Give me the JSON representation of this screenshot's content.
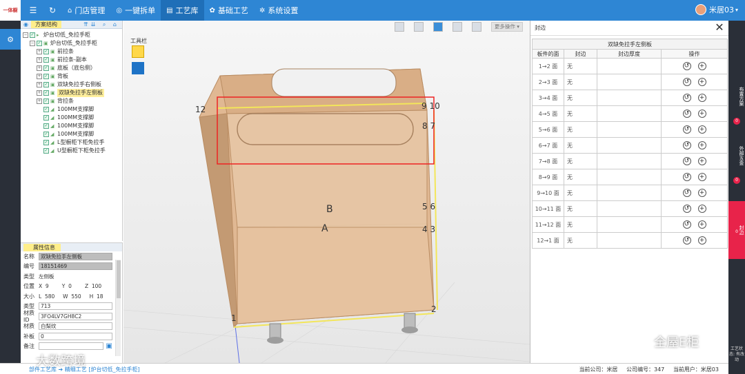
{
  "topbar": {
    "logo_text": "一体橱",
    "nav": [
      {
        "icon": "home-icon",
        "glyph": "⌂",
        "label": "门店管理"
      },
      {
        "icon": "shield-icon",
        "glyph": "◎",
        "label": "一键拆单"
      },
      {
        "icon": "book-icon",
        "glyph": "▤",
        "label": "工艺库"
      },
      {
        "icon": "palette-icon",
        "glyph": "✿",
        "label": "基础工艺"
      },
      {
        "icon": "gear-icon",
        "glyph": "✲",
        "label": "系统设置"
      }
    ],
    "username": "米居03"
  },
  "tree_panel": {
    "title": "方案结构",
    "items": [
      {
        "level": 0,
        "label": "炉台切低_免拉手柜"
      },
      {
        "level": 1,
        "label": "炉台切低_免拉手柜"
      },
      {
        "level": 2,
        "label": "前拉条"
      },
      {
        "level": 2,
        "label": "前拉条-副本"
      },
      {
        "level": 2,
        "label": "底板（底包侧）"
      },
      {
        "level": 2,
        "label": "背板"
      },
      {
        "level": 2,
        "label": "双缺免拉手右侧板"
      },
      {
        "level": 2,
        "label": "双缺免拉手左侧板",
        "selected": true
      },
      {
        "level": 2,
        "label": "背拉条"
      },
      {
        "level": 2,
        "label": "100MM支撑脚",
        "leaf": true
      },
      {
        "level": 2,
        "label": "100MM支撑脚",
        "leaf": true
      },
      {
        "level": 2,
        "label": "100MM支撑脚",
        "leaf": true
      },
      {
        "level": 2,
        "label": "100MM支撑脚",
        "leaf": true
      },
      {
        "level": 2,
        "label": "L型橱柜下柜免拉手",
        "leaf": true
      },
      {
        "level": 2,
        "label": "U型橱柜下柜免拉手",
        "leaf": true
      }
    ]
  },
  "prop_panel": {
    "title": "属性信息",
    "name_label": "名称",
    "name_value": "双缺免拉手左侧板",
    "code_label": "编号",
    "code_value": "18151469",
    "type_label": "类型",
    "type_value": "左侧板",
    "pos_label": "位置",
    "pos": "X  9        Y  0        Z  100",
    "size_label": "大小",
    "size": "L  580     W  550     H  18",
    "type2_label": "类型",
    "type2_value": "713",
    "matid_label": "材质ID",
    "matid_value": "3FO4LV7GH8C2",
    "mat_label": "材质",
    "mat_value": "白梨纹",
    "fill_label": "补板",
    "fill_value": "0",
    "note_label": "备注",
    "note_value": ""
  },
  "viewport": {
    "toolbox_label": "工具栏",
    "more_ops": "更多操作 ▾",
    "face_a": "A",
    "face_b": "B",
    "edge_labels": [
      "1",
      "2",
      "4 3",
      "5 6",
      "8 7",
      "9 10",
      "12"
    ]
  },
  "seal_panel": {
    "title": "封边",
    "caption": "双缺免拉手左侧板",
    "headers": [
      "板件的面",
      "封边",
      "封边厚度",
      "操作"
    ],
    "rows": [
      {
        "face": "1→2 面",
        "edge": "无"
      },
      {
        "face": "2→3 面",
        "edge": "无"
      },
      {
        "face": "3→4 面",
        "edge": "无"
      },
      {
        "face": "4→5 面",
        "edge": "无"
      },
      {
        "face": "5→6 面",
        "edge": "无"
      },
      {
        "face": "6→7 面",
        "edge": "无"
      },
      {
        "face": "7→8 面",
        "edge": "无"
      },
      {
        "face": "8→9 面",
        "edge": "无"
      },
      {
        "face": "9→10 面",
        "edge": "无"
      },
      {
        "face": "10→11 面",
        "edge": "无"
      },
      {
        "face": "11→12 面",
        "edge": "无"
      },
      {
        "face": "12→1 面",
        "edge": "无"
      }
    ]
  },
  "right_strip": {
    "tabs": [
      {
        "label": "布置方案",
        "count": "0"
      },
      {
        "label": "外部五金",
        "count": "0"
      },
      {
        "label": "封边",
        "count": "0",
        "active": true
      }
    ],
    "footer": "工艺状态: 有改动"
  },
  "statusbar": {
    "breadcrumb": "部件工艺库 ➔ 精细工艺 [炉台切低_免拉手柜]",
    "company": "当前公司：米居",
    "company_no": "公司编号：347",
    "user": "当前用户：米居03"
  },
  "watermarks": {
    "left": "大数跨境",
    "right": "全屋E柜"
  }
}
